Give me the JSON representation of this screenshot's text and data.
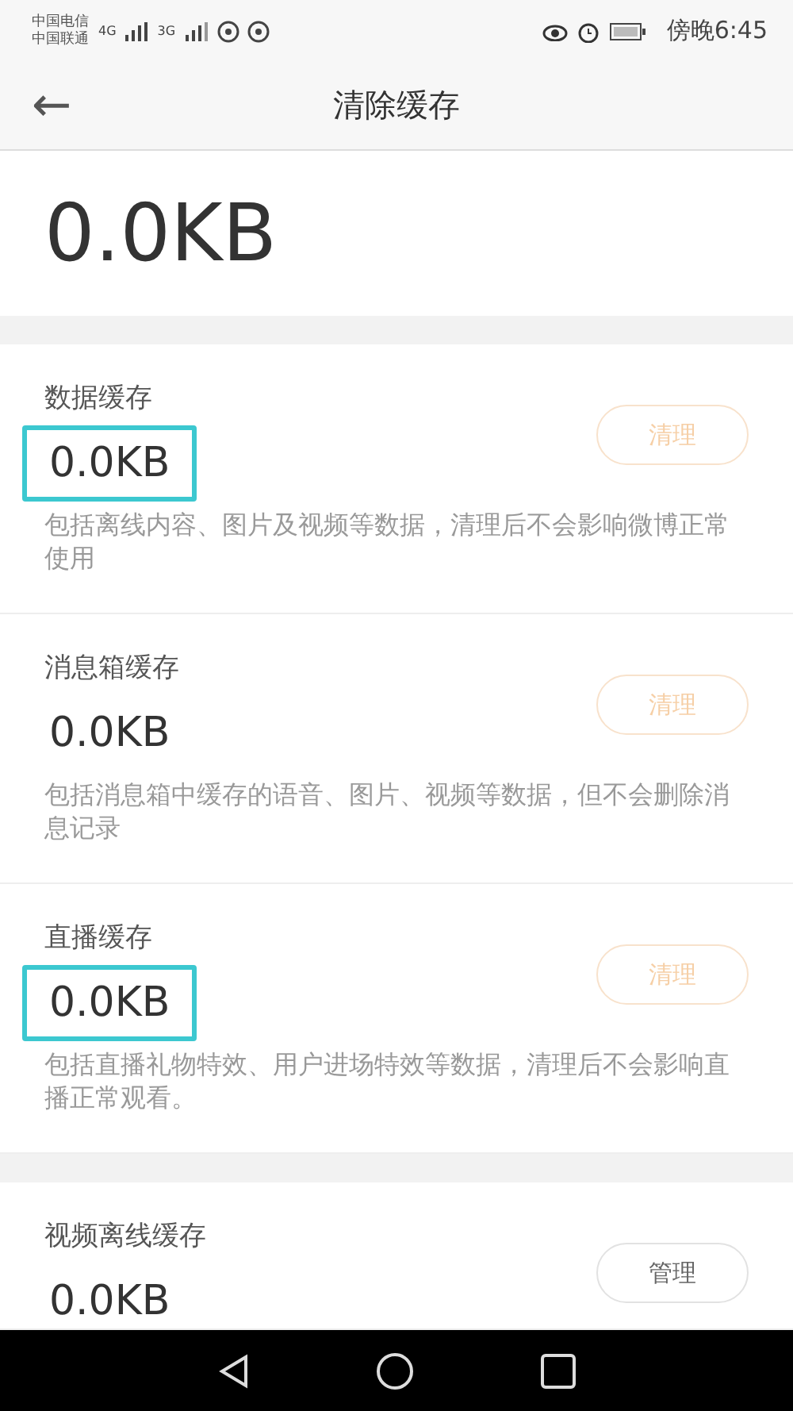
{
  "status_bar": {
    "carriers": [
      "中国电信",
      "中国联通"
    ],
    "network_1": "4G",
    "network_2": "3G",
    "time": "傍晚6:45"
  },
  "header": {
    "title": "清除缓存",
    "back": "←"
  },
  "total": {
    "value": "0.0KB"
  },
  "groups": [
    {
      "items": [
        {
          "title": "数据缓存",
          "value": "0.0KB",
          "highlighted": true,
          "description": "包括离线内容、图片及视频等数据，清理后不会影响微博正常使用",
          "button": {
            "label": "清理",
            "disabled": true
          }
        },
        {
          "title": "消息箱缓存",
          "value": "0.0KB",
          "highlighted": false,
          "description": "包括消息箱中缓存的语音、图片、视频等数据，但不会删除消息记录",
          "button": {
            "label": "清理",
            "disabled": true
          }
        },
        {
          "title": "直播缓存",
          "value": "0.0KB",
          "highlighted": true,
          "description": "包括直播礼物特效、用户进场特效等数据，清理后不会影响直播正常观看。",
          "button": {
            "label": "清理",
            "disabled": true
          }
        }
      ]
    },
    {
      "items": [
        {
          "title": "视频离线缓存",
          "value": "0.0KB",
          "highlighted": false,
          "button": {
            "label": "管理",
            "disabled": false
          }
        }
      ]
    }
  ]
}
